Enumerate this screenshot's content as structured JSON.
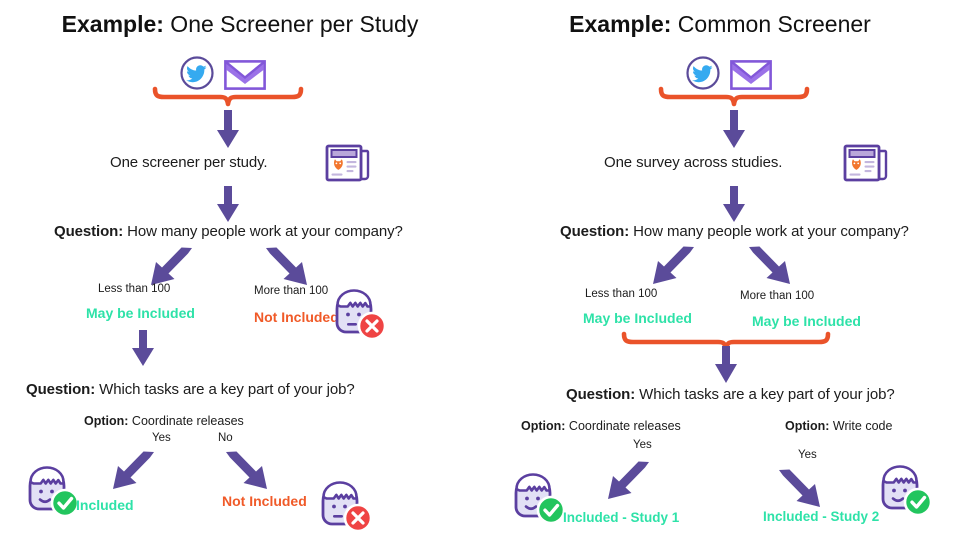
{
  "meta": {
    "colors": {
      "purple": "#5b4b9a",
      "orange_bracket": "#ea532a",
      "included_green": "#2ee2a8",
      "not_included_orange": "#f05a28",
      "twitter_blue": "#35aaf0",
      "face_fill": "#e2e0f5",
      "red_badge": "#ef4444",
      "green_badge": "#22c55e",
      "background": "#ffffff"
    }
  },
  "panels": [
    {
      "id": "one-screener-per-study",
      "title_strong": "Example:",
      "title_rest": " One Screener per Study",
      "sources": [
        {
          "icon": "twitter-icon",
          "name": "twitter"
        },
        {
          "icon": "envelope-icon",
          "name": "email"
        }
      ],
      "statement": "One screener per study.",
      "statement_icon": "newspaper-icon",
      "question_1_label": "Question:",
      "question_1_text": " How many people work at your company?",
      "branch_1_left_answer": "Less than 100",
      "branch_1_left_status": "May be Included",
      "branch_1_right_answer": "More than 100",
      "branch_1_right_status": "Not Included",
      "branch_1_right_face": "face-not-included-icon",
      "question_2_label": "Question:",
      "question_2_text": " Which tasks are a key part of your job?",
      "option_1_label": "Option:",
      "option_1_text": " Coordinate releases",
      "option_1_yes": "Yes",
      "option_1_no": "No",
      "outcome_left_status": "Included",
      "outcome_left_face": "face-included-icon",
      "outcome_right_status": "Not Included",
      "outcome_right_face": "face-not-included-icon"
    },
    {
      "id": "common-screener",
      "title_strong": "Example:",
      "title_rest": " Common Screener",
      "sources": [
        {
          "icon": "twitter-icon",
          "name": "twitter"
        },
        {
          "icon": "envelope-icon",
          "name": "email"
        }
      ],
      "statement": "One survey across studies.",
      "statement_icon": "newspaper-icon",
      "question_1_label": "Question:",
      "question_1_text": " How many people work at your company?",
      "branch_1_left_answer": "Less than 100",
      "branch_1_left_status": "May be Included",
      "branch_1_right_answer": "More than 100",
      "branch_1_right_status": "May be Included",
      "question_2_label": "Question:",
      "question_2_text": " Which tasks are a key part of your job?",
      "option_1_label": "Option:",
      "option_1_text": " Coordinate releases",
      "option_1_yes": "Yes",
      "option_2_label": "Option:",
      "option_2_text": " Write code",
      "option_2_yes": "Yes",
      "outcome_left_status": "Included - Study 1",
      "outcome_left_face": "face-included-icon",
      "outcome_right_status": "Included - Study 2",
      "outcome_right_face": "face-included-icon"
    }
  ]
}
